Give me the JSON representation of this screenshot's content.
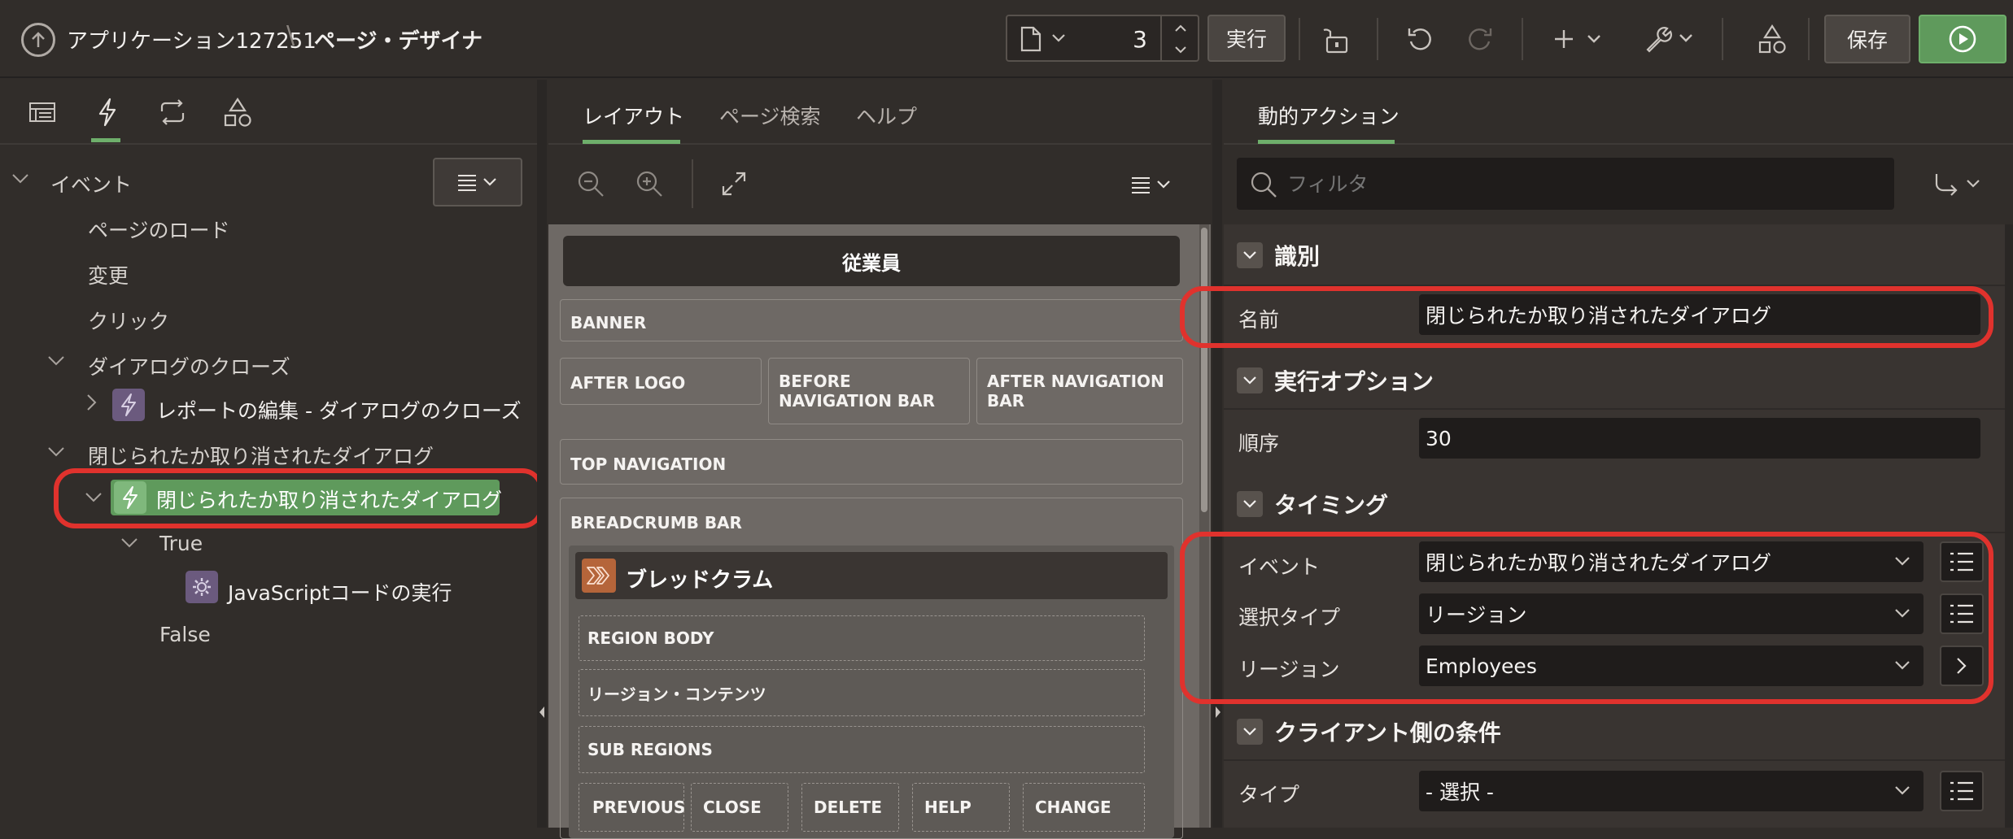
{
  "header": {
    "app_name": "アプリケーション127251",
    "separator": "\\",
    "page_designer": "ページ・デザイナ",
    "page_number": "3",
    "run_label": "実行",
    "save_label": "保存"
  },
  "left_panel": {
    "tree": {
      "events": "イベント",
      "page_load": "ページのロード",
      "change": "変更",
      "click": "クリック",
      "dialog_close": "ダイアログのクローズ",
      "edit_report_close": "レポートの編集 - ダイアログのクローズ",
      "dialog_closed_cancelled": "閉じられたか取り消されたダイアログ",
      "selected_da": "閉じられたか取り消されたダイアログ",
      "true_label": "True",
      "js_action": "JavaScriptコードの実行",
      "false_label": "False"
    }
  },
  "middle_panel": {
    "tabs": [
      "レイアウト",
      "ページ検索",
      "ヘルプ"
    ],
    "canvas": {
      "page_title": "従業員",
      "banner": "BANNER",
      "after_logo": "AFTER LOGO",
      "before_nav_bar": "BEFORE NAVIGATION BAR",
      "after_nav_bar": "AFTER NAVIGATION BAR",
      "top_navigation": "TOP NAVIGATION",
      "breadcrumb_bar": "BREADCRUMB BAR",
      "breadcrumb_region": "ブレッドクラム",
      "region_body": "REGION BODY",
      "region_content": "リージョン・コンテンツ",
      "sub_regions": "SUB REGIONS",
      "buttons": [
        "PREVIOUS",
        "CLOSE",
        "DELETE",
        "HELP",
        "CHANGE"
      ]
    }
  },
  "right_panel": {
    "tab": "動的アクション",
    "filter_placeholder": "フィルタ",
    "sections": {
      "identification": "識別",
      "execution_options": "実行オプション",
      "timing": "タイミング",
      "client_condition": "クライアント側の条件"
    },
    "props": {
      "name_label": "名前",
      "name_value": "閉じられたか取り消されたダイアログ",
      "sequence_label": "順序",
      "sequence_value": "30",
      "event_label": "イベント",
      "event_value": "閉じられたか取り消されたダイアログ",
      "selection_type_label": "選択タイプ",
      "selection_type_value": "リージョン",
      "region_label": "リージョン",
      "region_value": "Employees",
      "type_label": "タイプ",
      "type_value": "- 選択 -"
    }
  },
  "colors": {
    "accent_green": "#6eaf6b",
    "save_run_green": "#5f9a5c",
    "highlight_red": "#e0322d",
    "da_purple": "#6b5a7e",
    "breadcrumb_orange": "#b5653a"
  }
}
